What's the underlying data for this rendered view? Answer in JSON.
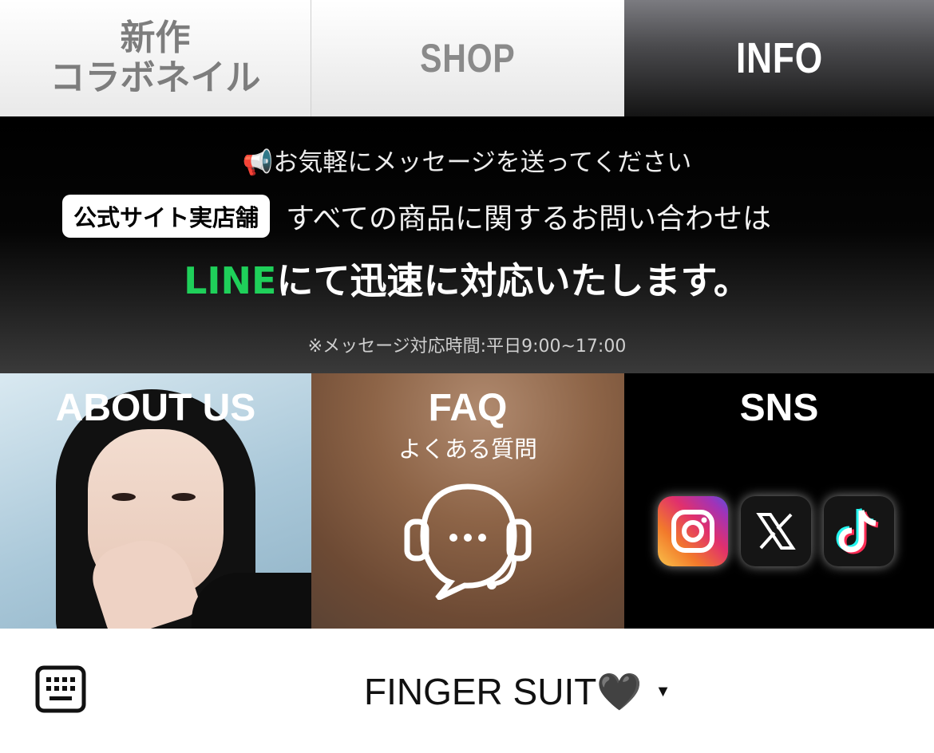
{
  "tabs": [
    {
      "line1": "新作",
      "line2": "コラボネイル"
    },
    {
      "label": "SHOP"
    },
    {
      "label": "INFO"
    }
  ],
  "banner": {
    "line1": "📢お気軽にメッセージを送ってください",
    "badge": "公式サイト実店舗",
    "line2": "すべての商品に関するお問い合わせは",
    "line3_brand": "LINE",
    "line3_rest": "にて迅速に対応いたします。",
    "note": "※メッセージ対応時間:平日9:00~17:00"
  },
  "cards": {
    "about": {
      "title": "ABOUT US"
    },
    "faq": {
      "title": "FAQ",
      "subtitle": "よくある質問"
    },
    "sns": {
      "title": "SNS",
      "icons": [
        "instagram-icon",
        "x-icon",
        "tiktok-icon"
      ]
    }
  },
  "footer": {
    "account_name": "FINGER SUIT🖤",
    "dropdown": "▼"
  },
  "colors": {
    "line_green": "#1fd05a",
    "banner_bg": "#000000"
  }
}
